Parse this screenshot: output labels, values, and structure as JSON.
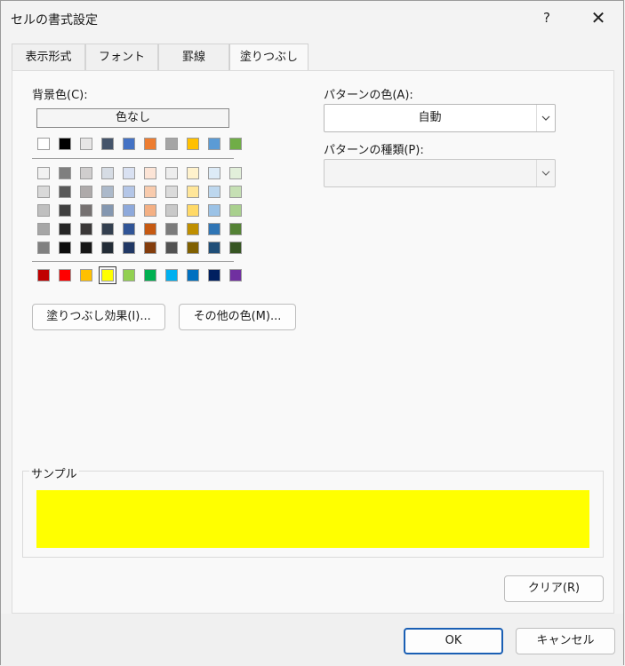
{
  "window": {
    "title": "セルの書式設定",
    "help": "?",
    "close": "✕"
  },
  "tabs": [
    {
      "label": "表示形式",
      "active": false
    },
    {
      "label": "フォント",
      "active": false
    },
    {
      "label": "罫線",
      "active": false
    },
    {
      "label": "塗りつぶし",
      "active": true
    }
  ],
  "background": {
    "label": "背景色(C):",
    "no_color": "色なし",
    "theme_row": [
      "#ffffff",
      "#000000",
      "#e7e6e6",
      "#44546a",
      "#4472c4",
      "#ed7d31",
      "#a5a5a5",
      "#ffc000",
      "#5b9bd5",
      "#70ad47"
    ],
    "shade_rows": [
      [
        "#f2f2f2",
        "#7f7f7f",
        "#d0cece",
        "#d6dce4",
        "#d9e1f2",
        "#fce4d6",
        "#ededed",
        "#fff2cc",
        "#ddebf7",
        "#e2efda"
      ],
      [
        "#d9d9d9",
        "#595959",
        "#aeaaaa",
        "#acb9ca",
        "#b4c6e7",
        "#f8cbad",
        "#dbdbdb",
        "#ffe699",
        "#bdd7ee",
        "#c6e0b4"
      ],
      [
        "#bfbfbf",
        "#404040",
        "#757171",
        "#8497b0",
        "#8ea9db",
        "#f4b084",
        "#c9c9c9",
        "#ffd966",
        "#9bc2e6",
        "#a9d08e"
      ],
      [
        "#a6a6a6",
        "#262626",
        "#3a3838",
        "#333f4f",
        "#305496",
        "#c65911",
        "#7b7b7b",
        "#bf8f00",
        "#2f75b5",
        "#548235"
      ],
      [
        "#808080",
        "#0d0d0d",
        "#161616",
        "#222b35",
        "#203764",
        "#833c0c",
        "#525252",
        "#806000",
        "#1f4e78",
        "#375623"
      ]
    ],
    "standard_row": [
      "#c00000",
      "#ff0000",
      "#ffc000",
      "#ffff00",
      "#92d050",
      "#00b050",
      "#00b0f0",
      "#0070c0",
      "#002060",
      "#7030a0"
    ],
    "selected_standard_index": 3
  },
  "buttons": {
    "fill_effects": "塗りつぶし効果(I)...",
    "more_colors": "その他の色(M)...",
    "clear": "クリア(R)",
    "ok": "OK",
    "cancel": "キャンセル"
  },
  "pattern": {
    "color_label": "パターンの色(A):",
    "color_value": "自動",
    "style_label": "パターンの種類(P):",
    "style_value": ""
  },
  "sample": {
    "label": "サンプル",
    "color": "#ffff00"
  }
}
